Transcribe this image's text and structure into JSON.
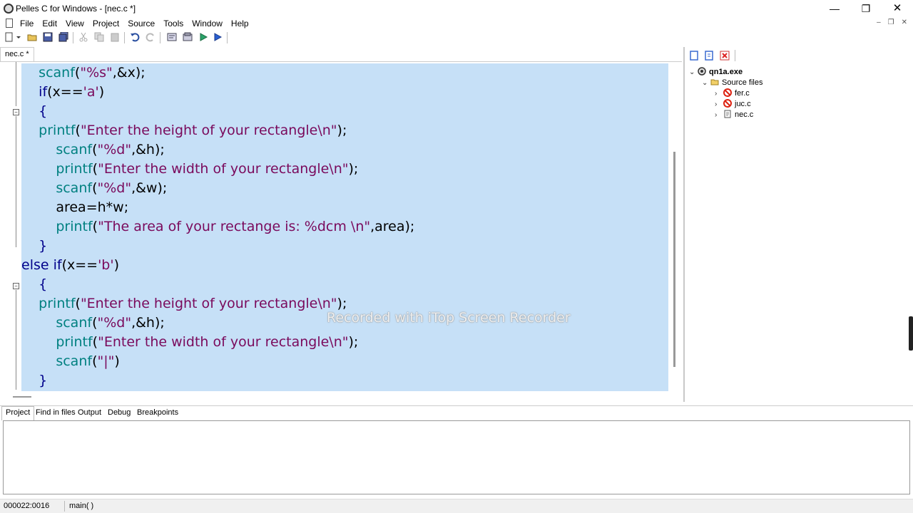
{
  "window": {
    "title": "Pelles C for Windows - [nec.c *]",
    "minimize_glyph": "—",
    "maximize_glyph": "❐",
    "close_glyph": "✕"
  },
  "menu": {
    "items": [
      "File",
      "Edit",
      "View",
      "Project",
      "Source",
      "Tools",
      "Window",
      "Help"
    ],
    "mdi_minimize": "–",
    "mdi_restore": "❐",
    "mdi_close": "✕"
  },
  "editor": {
    "tab_label": "nec.c *",
    "lines": [
      [
        {
          "t": "    "
        },
        {
          "t": "scanf",
          "c": "f"
        },
        {
          "t": "(",
          "c": "p"
        },
        {
          "t": "\"%s\"",
          "c": "s"
        },
        {
          "t": ",&x);",
          "c": "p"
        }
      ],
      [
        {
          "t": "    "
        },
        {
          "t": "if",
          "c": "k"
        },
        {
          "t": "(x==",
          "c": "p"
        },
        {
          "t": "'a'",
          "c": "s"
        },
        {
          "t": ")",
          "c": "p"
        }
      ],
      [
        {
          "t": "    "
        },
        {
          "t": "{",
          "c": "k"
        }
      ],
      [
        {
          "t": "    "
        },
        {
          "t": "printf",
          "c": "f"
        },
        {
          "t": "(",
          "c": "p"
        },
        {
          "t": "\"Enter the height of your rectangle\\n\"",
          "c": "s"
        },
        {
          "t": ");",
          "c": "p"
        }
      ],
      [
        {
          "t": "        "
        },
        {
          "t": "scanf",
          "c": "f"
        },
        {
          "t": "(",
          "c": "p"
        },
        {
          "t": "\"%d\"",
          "c": "s"
        },
        {
          "t": ",&h);",
          "c": "p"
        }
      ],
      [
        {
          "t": "        "
        },
        {
          "t": "printf",
          "c": "f"
        },
        {
          "t": "(",
          "c": "p"
        },
        {
          "t": "\"Enter the width of your rectangle\\n\"",
          "c": "s"
        },
        {
          "t": ");",
          "c": "p"
        }
      ],
      [
        {
          "t": "        "
        },
        {
          "t": "scanf",
          "c": "f"
        },
        {
          "t": "(",
          "c": "p"
        },
        {
          "t": "\"%d\"",
          "c": "s"
        },
        {
          "t": ",&w);",
          "c": "p"
        }
      ],
      [
        {
          "t": "        "
        },
        {
          "t": "area=h*w;",
          "c": "p"
        }
      ],
      [
        {
          "t": "        "
        },
        {
          "t": "printf",
          "c": "f"
        },
        {
          "t": "(",
          "c": "p"
        },
        {
          "t": "\"The area of your rectange is: %dcm \\n\"",
          "c": "s"
        },
        {
          "t": ",area);",
          "c": "p"
        }
      ],
      [
        {
          "t": "    "
        },
        {
          "t": "}",
          "c": "k"
        }
      ],
      [
        {
          "t": "else if",
          "c": "k"
        },
        {
          "t": "(x==",
          "c": "p"
        },
        {
          "t": "'b'",
          "c": "s"
        },
        {
          "t": ")",
          "c": "p"
        }
      ],
      [
        {
          "t": "    "
        },
        {
          "t": "{",
          "c": "k"
        }
      ],
      [
        {
          "t": "    "
        },
        {
          "t": "printf",
          "c": "f"
        },
        {
          "t": "(",
          "c": "p"
        },
        {
          "t": "\"Enter the height of your rectangle\\n\"",
          "c": "s"
        },
        {
          "t": ");",
          "c": "p"
        }
      ],
      [
        {
          "t": "        "
        },
        {
          "t": "scanf",
          "c": "f"
        },
        {
          "t": "(",
          "c": "p"
        },
        {
          "t": "\"%d\"",
          "c": "s"
        },
        {
          "t": ",&h);",
          "c": "p"
        }
      ],
      [
        {
          "t": "        "
        },
        {
          "t": "printf",
          "c": "f"
        },
        {
          "t": "(",
          "c": "p"
        },
        {
          "t": "\"Enter the width of your rectangle\\n\"",
          "c": "s"
        },
        {
          "t": ");",
          "c": "p"
        }
      ],
      [
        {
          "t": "        "
        },
        {
          "t": "scanf",
          "c": "f"
        },
        {
          "t": "(",
          "c": "p"
        },
        {
          "t": "\"|\"",
          "c": "s"
        },
        {
          "t": ")",
          "c": "p"
        }
      ],
      [
        {
          "t": "    "
        },
        {
          "t": "}",
          "c": "k"
        }
      ]
    ],
    "watermark": "Recorded with iTop Screen Recorder"
  },
  "project_tree": {
    "root": "qn1a.exe",
    "folder": "Source files",
    "files": [
      {
        "name": "fer.c",
        "status": "error"
      },
      {
        "name": "juc.c",
        "status": "error"
      },
      {
        "name": "nec.c",
        "status": "ok"
      }
    ]
  },
  "bottom_tabs": [
    "Project",
    "Find in files",
    "Output",
    "Debug",
    "Breakpoints"
  ],
  "status": {
    "position": "000022:0016",
    "function": "main( )"
  },
  "colors": {
    "selection": "#c6e0f7",
    "keyword": "#00008b",
    "function": "#008080",
    "string": "#7a0a5c"
  }
}
